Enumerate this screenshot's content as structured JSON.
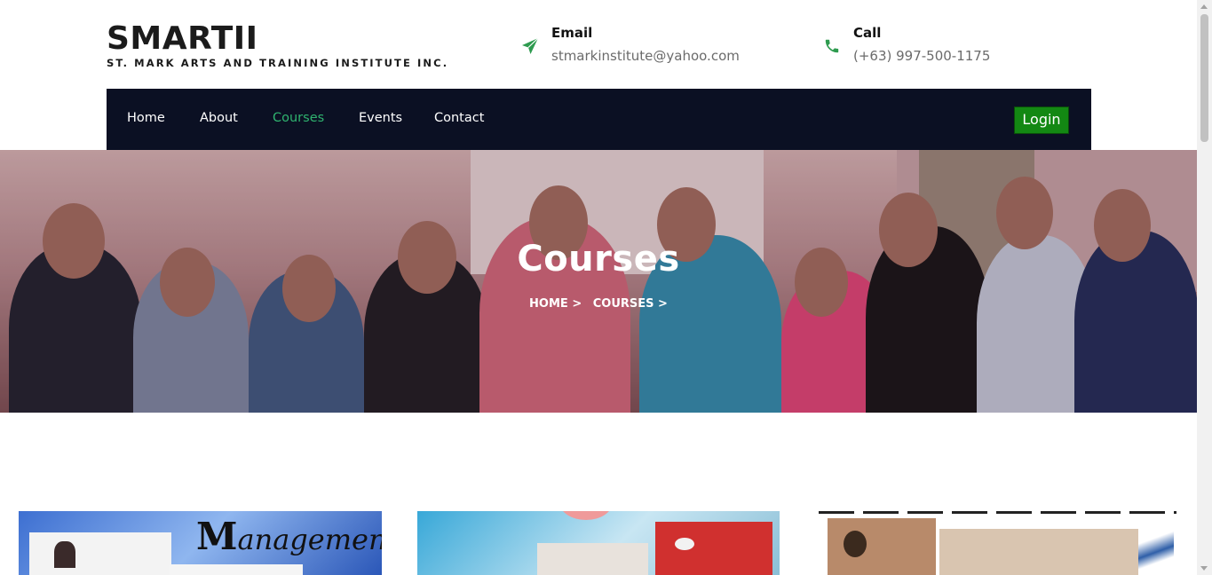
{
  "brand": {
    "title": "SMARTII",
    "subtitle": "ST. MARK ARTS AND TRAINING INSTITUTE INC."
  },
  "contact": {
    "email": {
      "label": "Email",
      "value": "stmarkinstitute@yahoo.com",
      "icon": "paper-plane-icon"
    },
    "call": {
      "label": "Call",
      "value": "(+63) 997-500-1175",
      "icon": "phone-icon"
    }
  },
  "nav": {
    "items": [
      {
        "label": "Home",
        "active": false
      },
      {
        "label": "About",
        "active": false
      },
      {
        "label": "Courses",
        "active": true
      },
      {
        "label": "Events",
        "active": false
      },
      {
        "label": "Contact",
        "active": false
      }
    ],
    "login": "Login"
  },
  "hero": {
    "title": "Courses",
    "breadcrumb": [
      "HOME >",
      "COURSES >"
    ]
  },
  "courses": [
    {
      "banner_text_initial": "M",
      "banner_text_rest": "anagement"
    }
  ],
  "colors": {
    "nav_bg": "#0b1023",
    "active": "#2fb36f",
    "login_bg": "#138813",
    "icon_green": "#2e9b4f"
  }
}
